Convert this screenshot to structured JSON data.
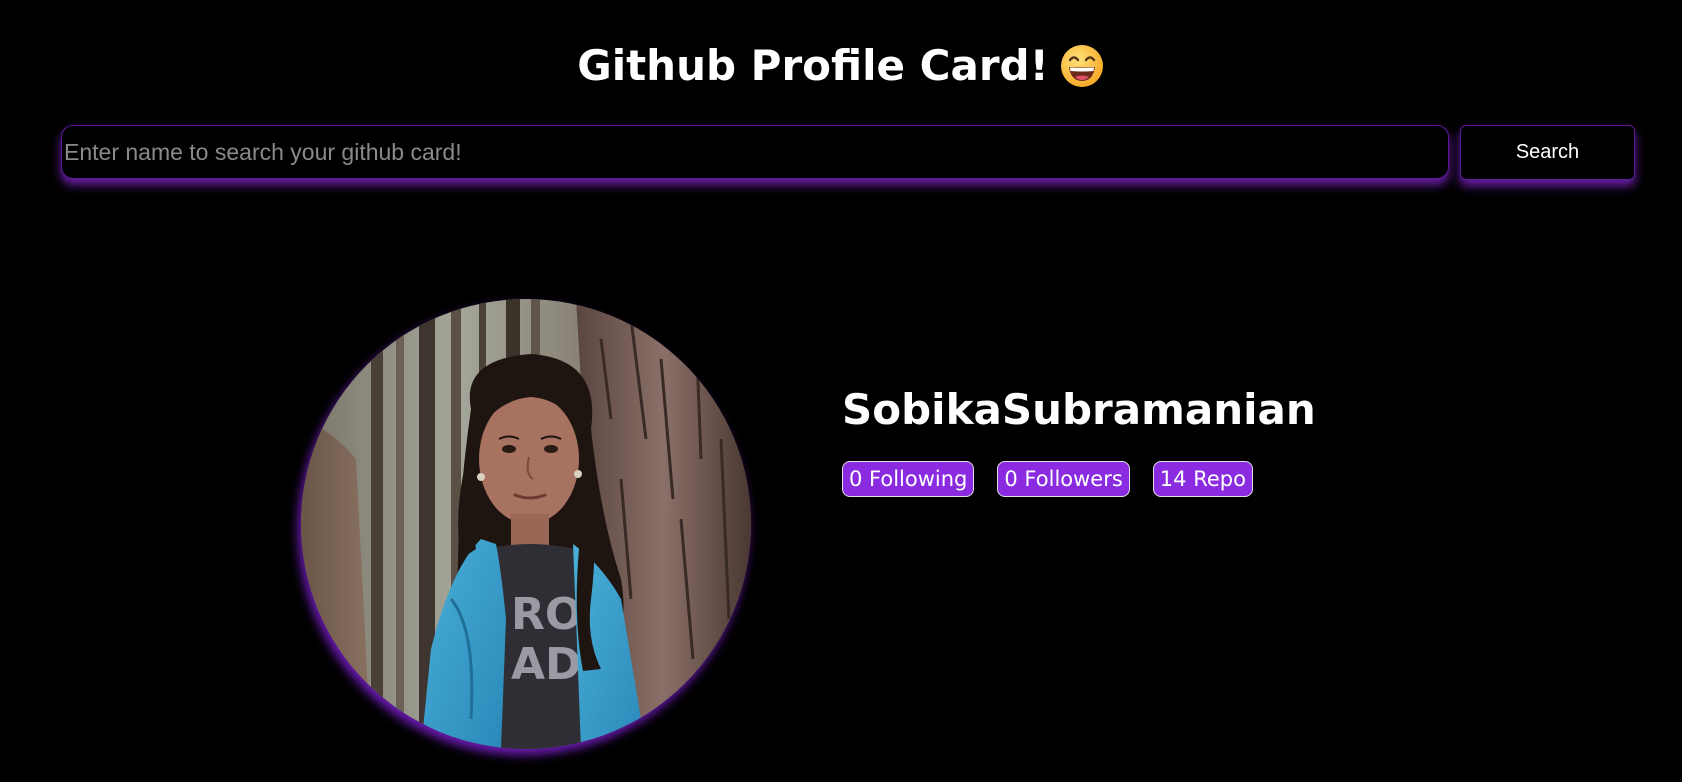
{
  "header": {
    "title": "Github Profile Card!",
    "emoji_icon": "grinning-face-icon"
  },
  "search": {
    "placeholder": "Enter name to search your github card!",
    "value": "",
    "button_label": "Search"
  },
  "profile": {
    "avatar_icon": "profile-photo",
    "username": "SobikaSubramanian",
    "stats": [
      {
        "label": "0 Following"
      },
      {
        "label": "0 Followers"
      },
      {
        "label": "14 Repo"
      }
    ]
  },
  "colors": {
    "background": "#000000",
    "accent": "#8a2be2",
    "glow": "#6a1fb0",
    "text": "#ffffff",
    "placeholder": "#8a8a8a"
  }
}
